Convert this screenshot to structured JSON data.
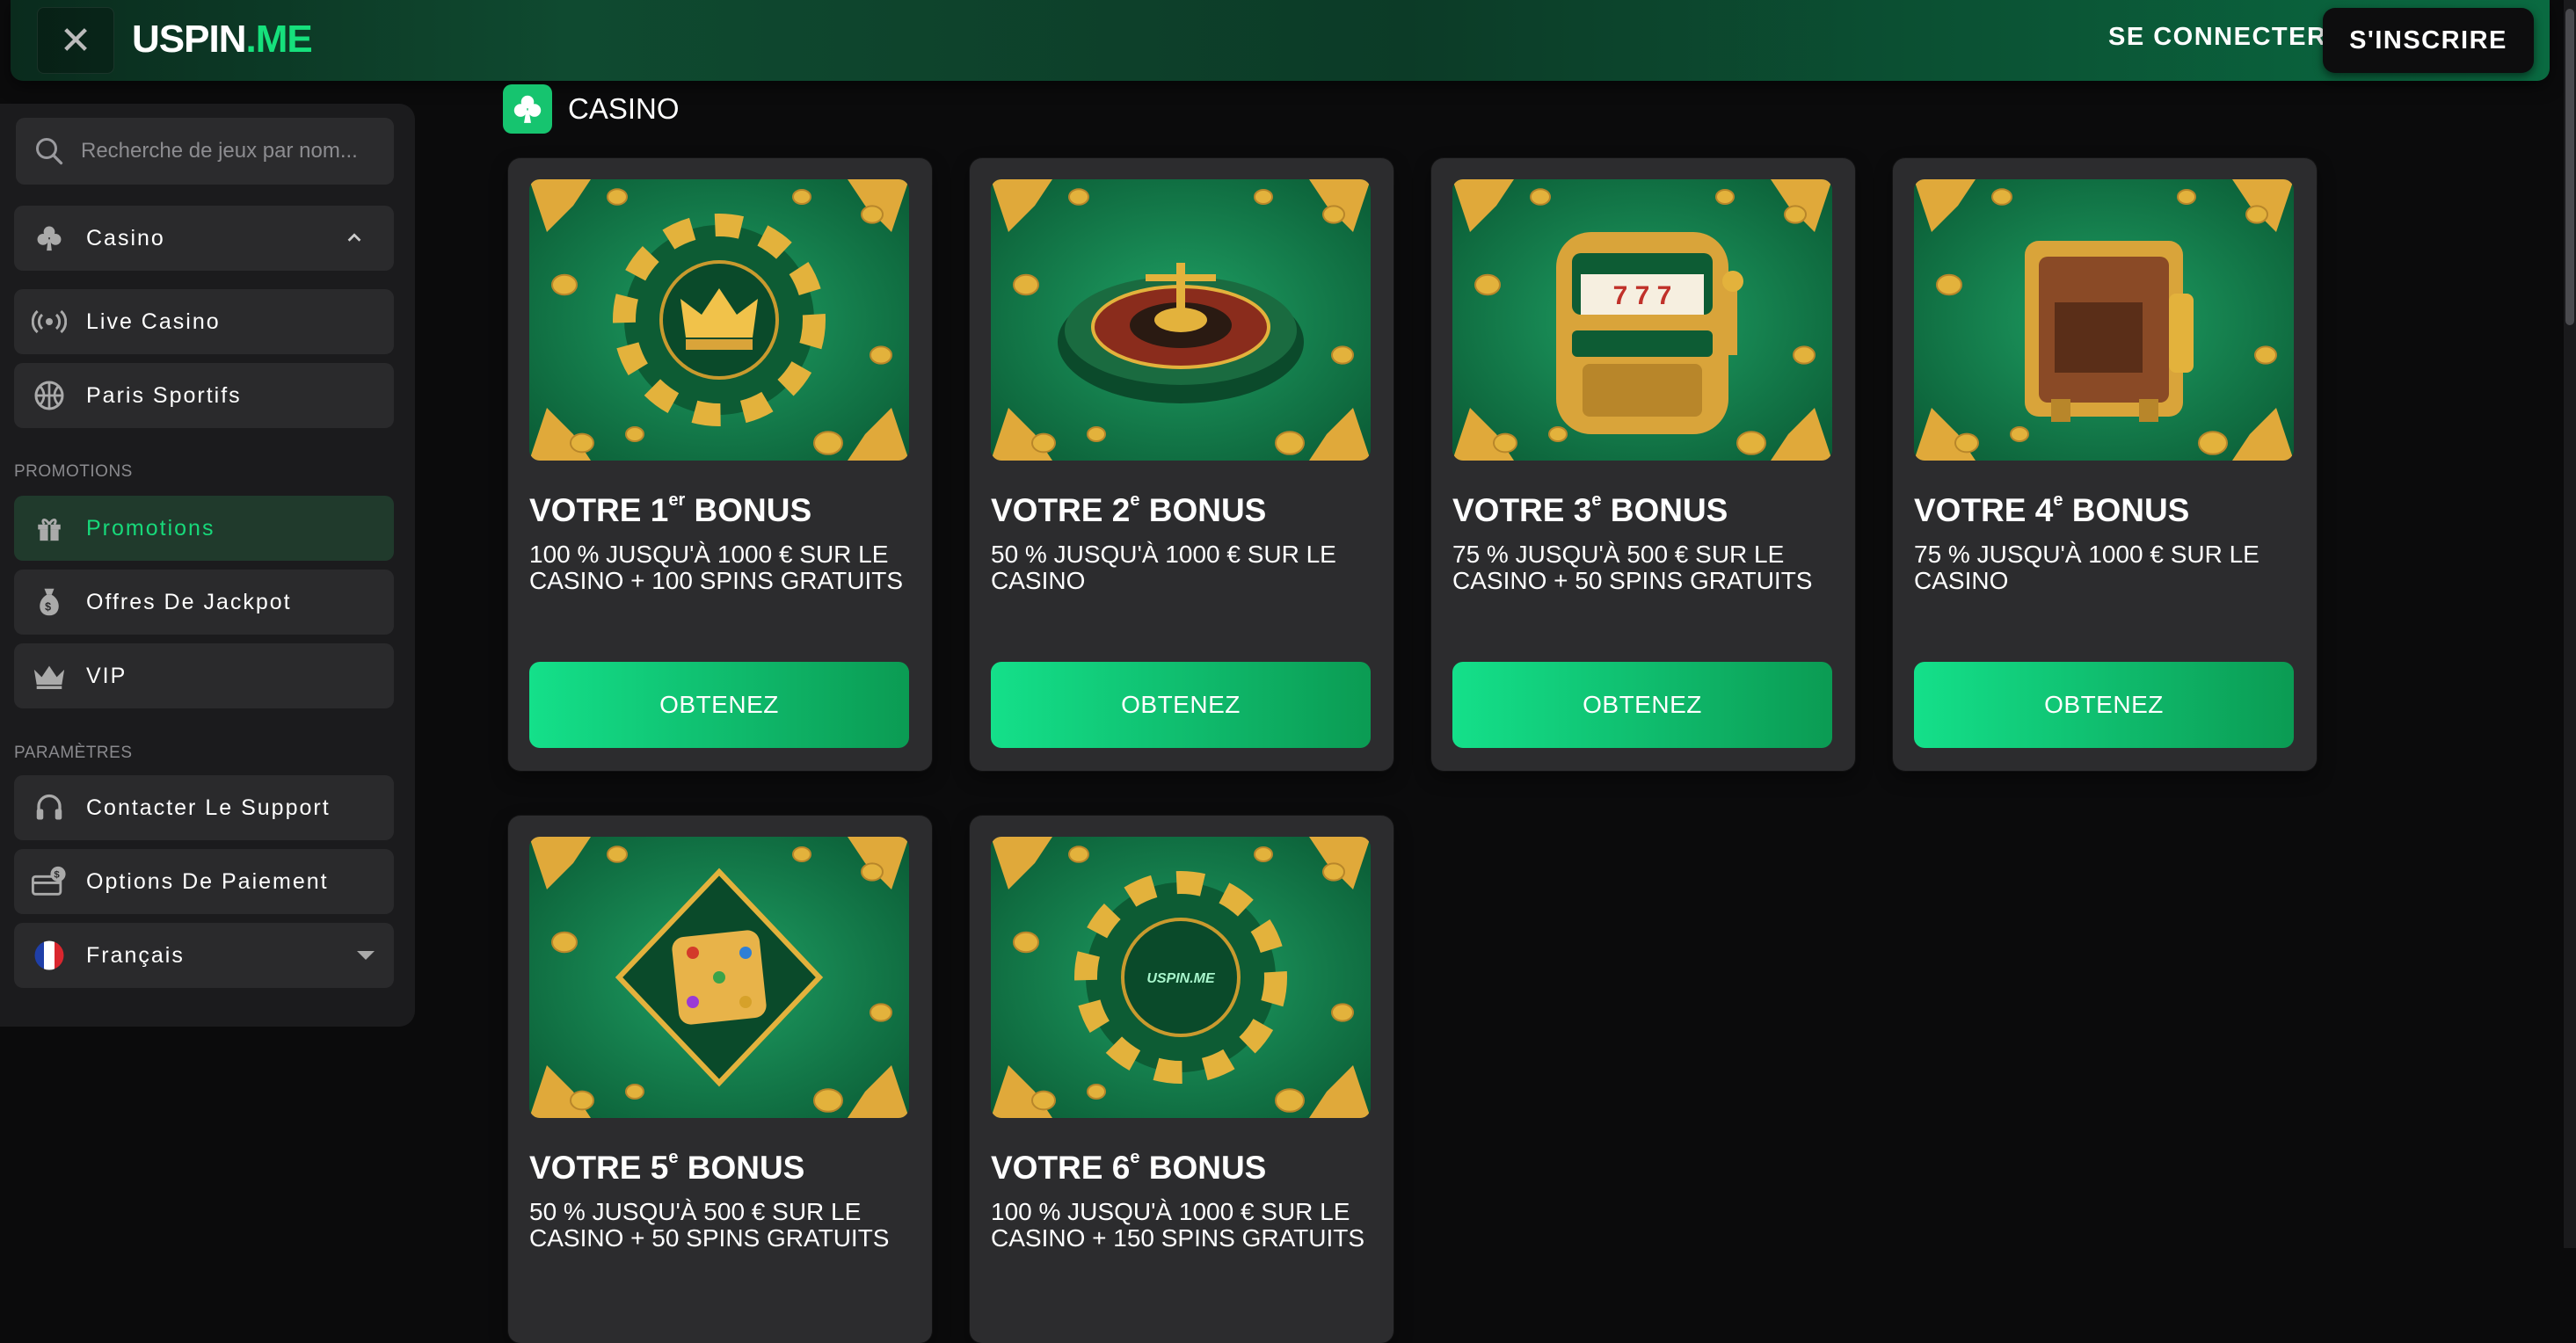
{
  "header": {
    "logo_main": "USPIN",
    "logo_suffix": ".ME",
    "login_label": "SE CONNECTER",
    "signup_label": "S'INSCRIRE"
  },
  "sidebar": {
    "search_placeholder": "Recherche de jeux par nom...",
    "items": [
      {
        "label": "Casino",
        "icon": "club-icon"
      },
      {
        "label": "Live Casino",
        "icon": "broadcast-icon"
      },
      {
        "label": "Paris Sportifs",
        "icon": "sports-ball-icon"
      }
    ],
    "promotions_section": "PROMOTIONS",
    "promo_items": [
      {
        "label": "Promotions",
        "icon": "gift-icon",
        "active": true
      },
      {
        "label": "Offres De Jackpot",
        "icon": "money-bag-icon"
      },
      {
        "label": "VIP",
        "icon": "crown-icon"
      }
    ],
    "settings_section": "PARAMÈTRES",
    "settings_items": [
      {
        "label": "Contacter Le Support",
        "icon": "headset-icon"
      },
      {
        "label": "Options De Paiement",
        "icon": "payment-card-icon"
      },
      {
        "label": "Français",
        "icon": "france-flag-icon"
      }
    ]
  },
  "main": {
    "heading": "CASINO",
    "cta_label": "OBTENEZ",
    "bonuses": [
      {
        "prefix": "VOTRE 1",
        "sup": "er",
        "suffix": " BONUS",
        "desc": "100 % JUSQU'À 1000 € SUR LE CASINO + 100 SPINS GRATUITS",
        "art": "crown-chip"
      },
      {
        "prefix": "VOTRE 2",
        "sup": "e",
        "suffix": " BONUS",
        "desc": "50 % JUSQU'À 1000 € SUR LE CASINO",
        "art": "roulette"
      },
      {
        "prefix": "VOTRE 3",
        "sup": "e",
        "suffix": " BONUS",
        "desc": "75 % JUSQU'À 500 € SUR LE CASINO + 50 SPINS GRATUITS",
        "art": "slot-machine"
      },
      {
        "prefix": "VOTRE 4",
        "sup": "e",
        "suffix": " BONUS",
        "desc": "75 % JUSQU'À 1000 € SUR LE CASINO",
        "art": "safe"
      },
      {
        "prefix": "VOTRE 5",
        "sup": "e",
        "suffix": " BONUS",
        "desc": "50 % JUSQU'À 500 € SUR LE CASINO + 50 SPINS GRATUITS",
        "art": "dice"
      },
      {
        "prefix": "VOTRE 6",
        "sup": "e",
        "suffix": " BONUS",
        "desc": "100 % JUSQU'À 1000 € SUR LE CASINO + 150 SPINS GRATUITS",
        "art": "logo-chip",
        "chip_text": "USPIN.ME"
      }
    ]
  }
}
